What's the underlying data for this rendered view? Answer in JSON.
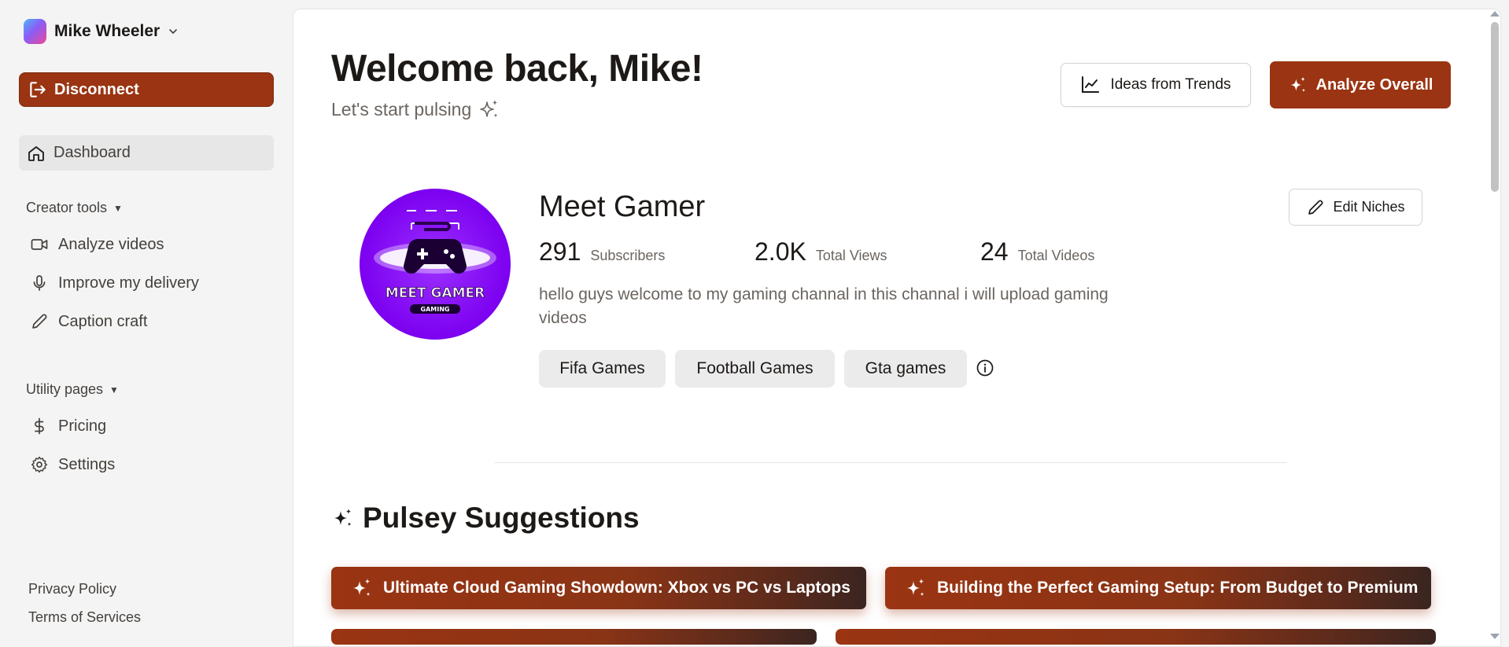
{
  "account": {
    "name": "Mike Wheeler"
  },
  "sidebar": {
    "disconnect_label": "Disconnect",
    "dashboard_label": "Dashboard",
    "creator_tools_heading": "Creator tools",
    "creator_tools": [
      {
        "label": "Analyze videos",
        "icon": "video-camera-icon"
      },
      {
        "label": "Improve my delivery",
        "icon": "microphone-icon"
      },
      {
        "label": "Caption craft",
        "icon": "pencil-icon"
      }
    ],
    "utility_heading": "Utility pages",
    "utility_pages": [
      {
        "label": "Pricing",
        "icon": "dollar-icon"
      },
      {
        "label": "Settings",
        "icon": "gear-icon"
      }
    ],
    "footer": {
      "privacy": "Privacy Policy",
      "terms": "Terms of Services"
    }
  },
  "header": {
    "welcome": "Welcome back, Mike!",
    "subtitle": "Let's start pulsing",
    "trends_button": "Ideas from Trends",
    "analyze_button": "Analyze Overall"
  },
  "channel": {
    "name": "Meet Gamer",
    "avatar_text": "MEET GAMER",
    "avatar_subtext": "GAMING",
    "stats": {
      "subscribers": {
        "value": "291",
        "label": "Subscribers"
      },
      "views": {
        "value": "2.0K",
        "label": "Total Views"
      },
      "videos": {
        "value": "24",
        "label": "Total Videos"
      }
    },
    "description": "hello guys welcome to my gaming channal in this channal i will upload gaming videos",
    "niches": [
      "Fifa Games",
      "Football Games",
      "Gta games"
    ],
    "edit_niches_button": "Edit Niches"
  },
  "suggestions": {
    "title": "Pulsey Suggestions",
    "items": [
      "Ultimate Cloud Gaming Showdown: Xbox vs PC vs Laptops",
      "Building the Perfect Gaming Setup: From Budget to Premium"
    ]
  },
  "colors": {
    "accent": "#9a3412",
    "sidebar_bg": "#f4f4f4",
    "avatar_purple": "#7c00f0"
  }
}
